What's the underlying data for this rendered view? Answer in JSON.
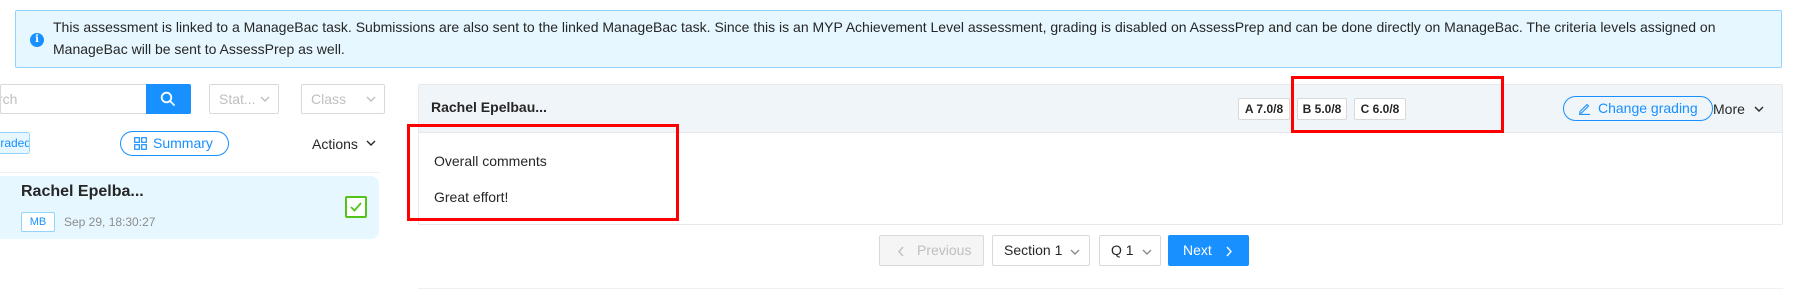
{
  "banner": {
    "message": "This assessment is linked to a ManageBac task. Submissions are also sent to the linked ManageBac task. Since this is an MYP Achievement Level assessment, grading is disabled on AssessPrep and can be done directly on ManageBac. The criteria levels assigned on ManageBac will be sent to AssessPrep as well.",
    "icon": "info-icon"
  },
  "filters": {
    "search_value": "Search",
    "status_placeholder": "Stat...",
    "class_placeholder": "Class"
  },
  "list_toolbar": {
    "graded_label": "Graded",
    "summary_label": "Summary",
    "actions_label": "Actions"
  },
  "students": [
    {
      "name": "Rachel Epelba...",
      "source_tag": "MB",
      "submitted": "Sep 29, 18:30:27",
      "checked": true
    }
  ],
  "panel": {
    "student_name": "Rachel Epelbau...",
    "criteria": [
      {
        "label": "A 7.0/8"
      },
      {
        "label": "B 5.0/8"
      },
      {
        "label": "C 6.0/8"
      }
    ],
    "change_grading_label": "Change grading",
    "more_label": "More",
    "comments_heading": "Overall comments",
    "comment": "Great effort!"
  },
  "pager": {
    "previous_label": "Previous",
    "section_value": "Section 1",
    "question_value": "Q 1",
    "next_label": "Next"
  },
  "colors": {
    "primary": "#1890ff",
    "highlight": "#ff0000",
    "success": "#52c41a",
    "banner_bg": "#e6f7ff"
  }
}
